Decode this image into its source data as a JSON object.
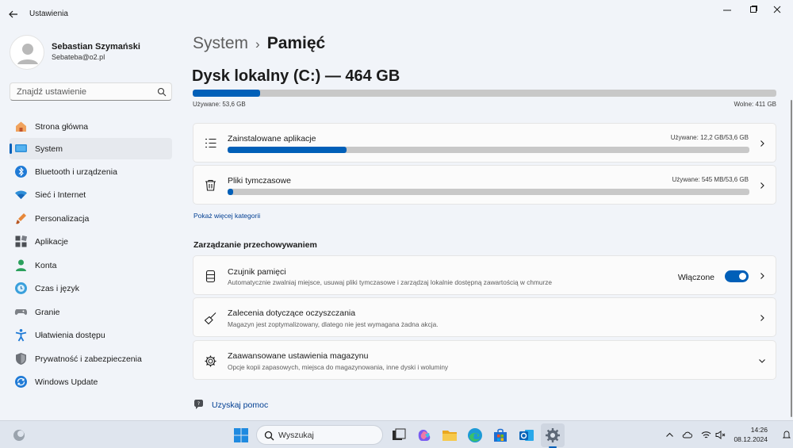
{
  "window": {
    "app_title": "Ustawienia"
  },
  "sidebar": {
    "user_name": "Sebastian Szymański",
    "user_email": "Sebateba@o2.pl",
    "search_placeholder": "Znajdź ustawienie",
    "items": [
      {
        "label": "Strona główna",
        "icon": "home-icon"
      },
      {
        "label": "System",
        "icon": "system-icon",
        "active": true
      },
      {
        "label": "Bluetooth i urządzenia",
        "icon": "bluetooth-icon"
      },
      {
        "label": "Sieć i Internet",
        "icon": "network-icon"
      },
      {
        "label": "Personalizacja",
        "icon": "personalization-icon"
      },
      {
        "label": "Aplikacje",
        "icon": "apps-icon"
      },
      {
        "label": "Konta",
        "icon": "accounts-icon"
      },
      {
        "label": "Czas i język",
        "icon": "time-language-icon"
      },
      {
        "label": "Granie",
        "icon": "gaming-icon"
      },
      {
        "label": "Ułatwienia dostępu",
        "icon": "accessibility-icon"
      },
      {
        "label": "Prywatność i zabezpieczenia",
        "icon": "privacy-shield-icon"
      },
      {
        "label": "Windows Update",
        "icon": "windows-update-icon"
      }
    ]
  },
  "main": {
    "breadcrumb_parent": "System",
    "breadcrumb_sep": "›",
    "breadcrumb_current": "Pamięć",
    "disk_title": "Dysk lokalny (C:) — 464 GB",
    "disk_used_label": "Używane: 53,6 GB",
    "disk_free_label": "Wolne: 411 GB",
    "disk_used_fraction": 0.115,
    "categories": [
      {
        "title": "Zainstalowane aplikacje",
        "usage": "Używane: 12,2 GB/53,6 GB",
        "fraction": 0.228,
        "icon": "apps-list-icon"
      },
      {
        "title": "Pliki tymczasowe",
        "usage": "Używane: 545 MB/53,6 GB",
        "fraction": 0.01,
        "icon": "trash-icon"
      }
    ],
    "show_more_label": "Pokaż więcej kategorii",
    "management_title": "Zarządzanie przechowywaniem",
    "storage_sense": {
      "title": "Czujnik pamięci",
      "subtitle": "Automatycznie zwalniaj miejsce, usuwaj pliki tymczasowe i zarządzaj lokalnie dostępną zawartością w chmurze",
      "toggle_label": "Włączone",
      "enabled": true
    },
    "cleanup": {
      "title": "Zalecenia dotyczące oczyszczania",
      "subtitle": "Magazyn jest zoptymalizowany, dlatego nie jest wymagana żadna akcja."
    },
    "advanced": {
      "title": "Zaawansowane ustawienia magazynu",
      "subtitle": "Opcje kopii zapasowych, miejsca do magazynowania, inne dyski i woluminy"
    },
    "help_label": "Uzyskaj pomoc"
  },
  "taskbar": {
    "search_label": "Wyszukaj",
    "time": "14:26",
    "date": "08.12.2024"
  },
  "colors": {
    "accent": "#005fb8",
    "link": "#003e92"
  }
}
